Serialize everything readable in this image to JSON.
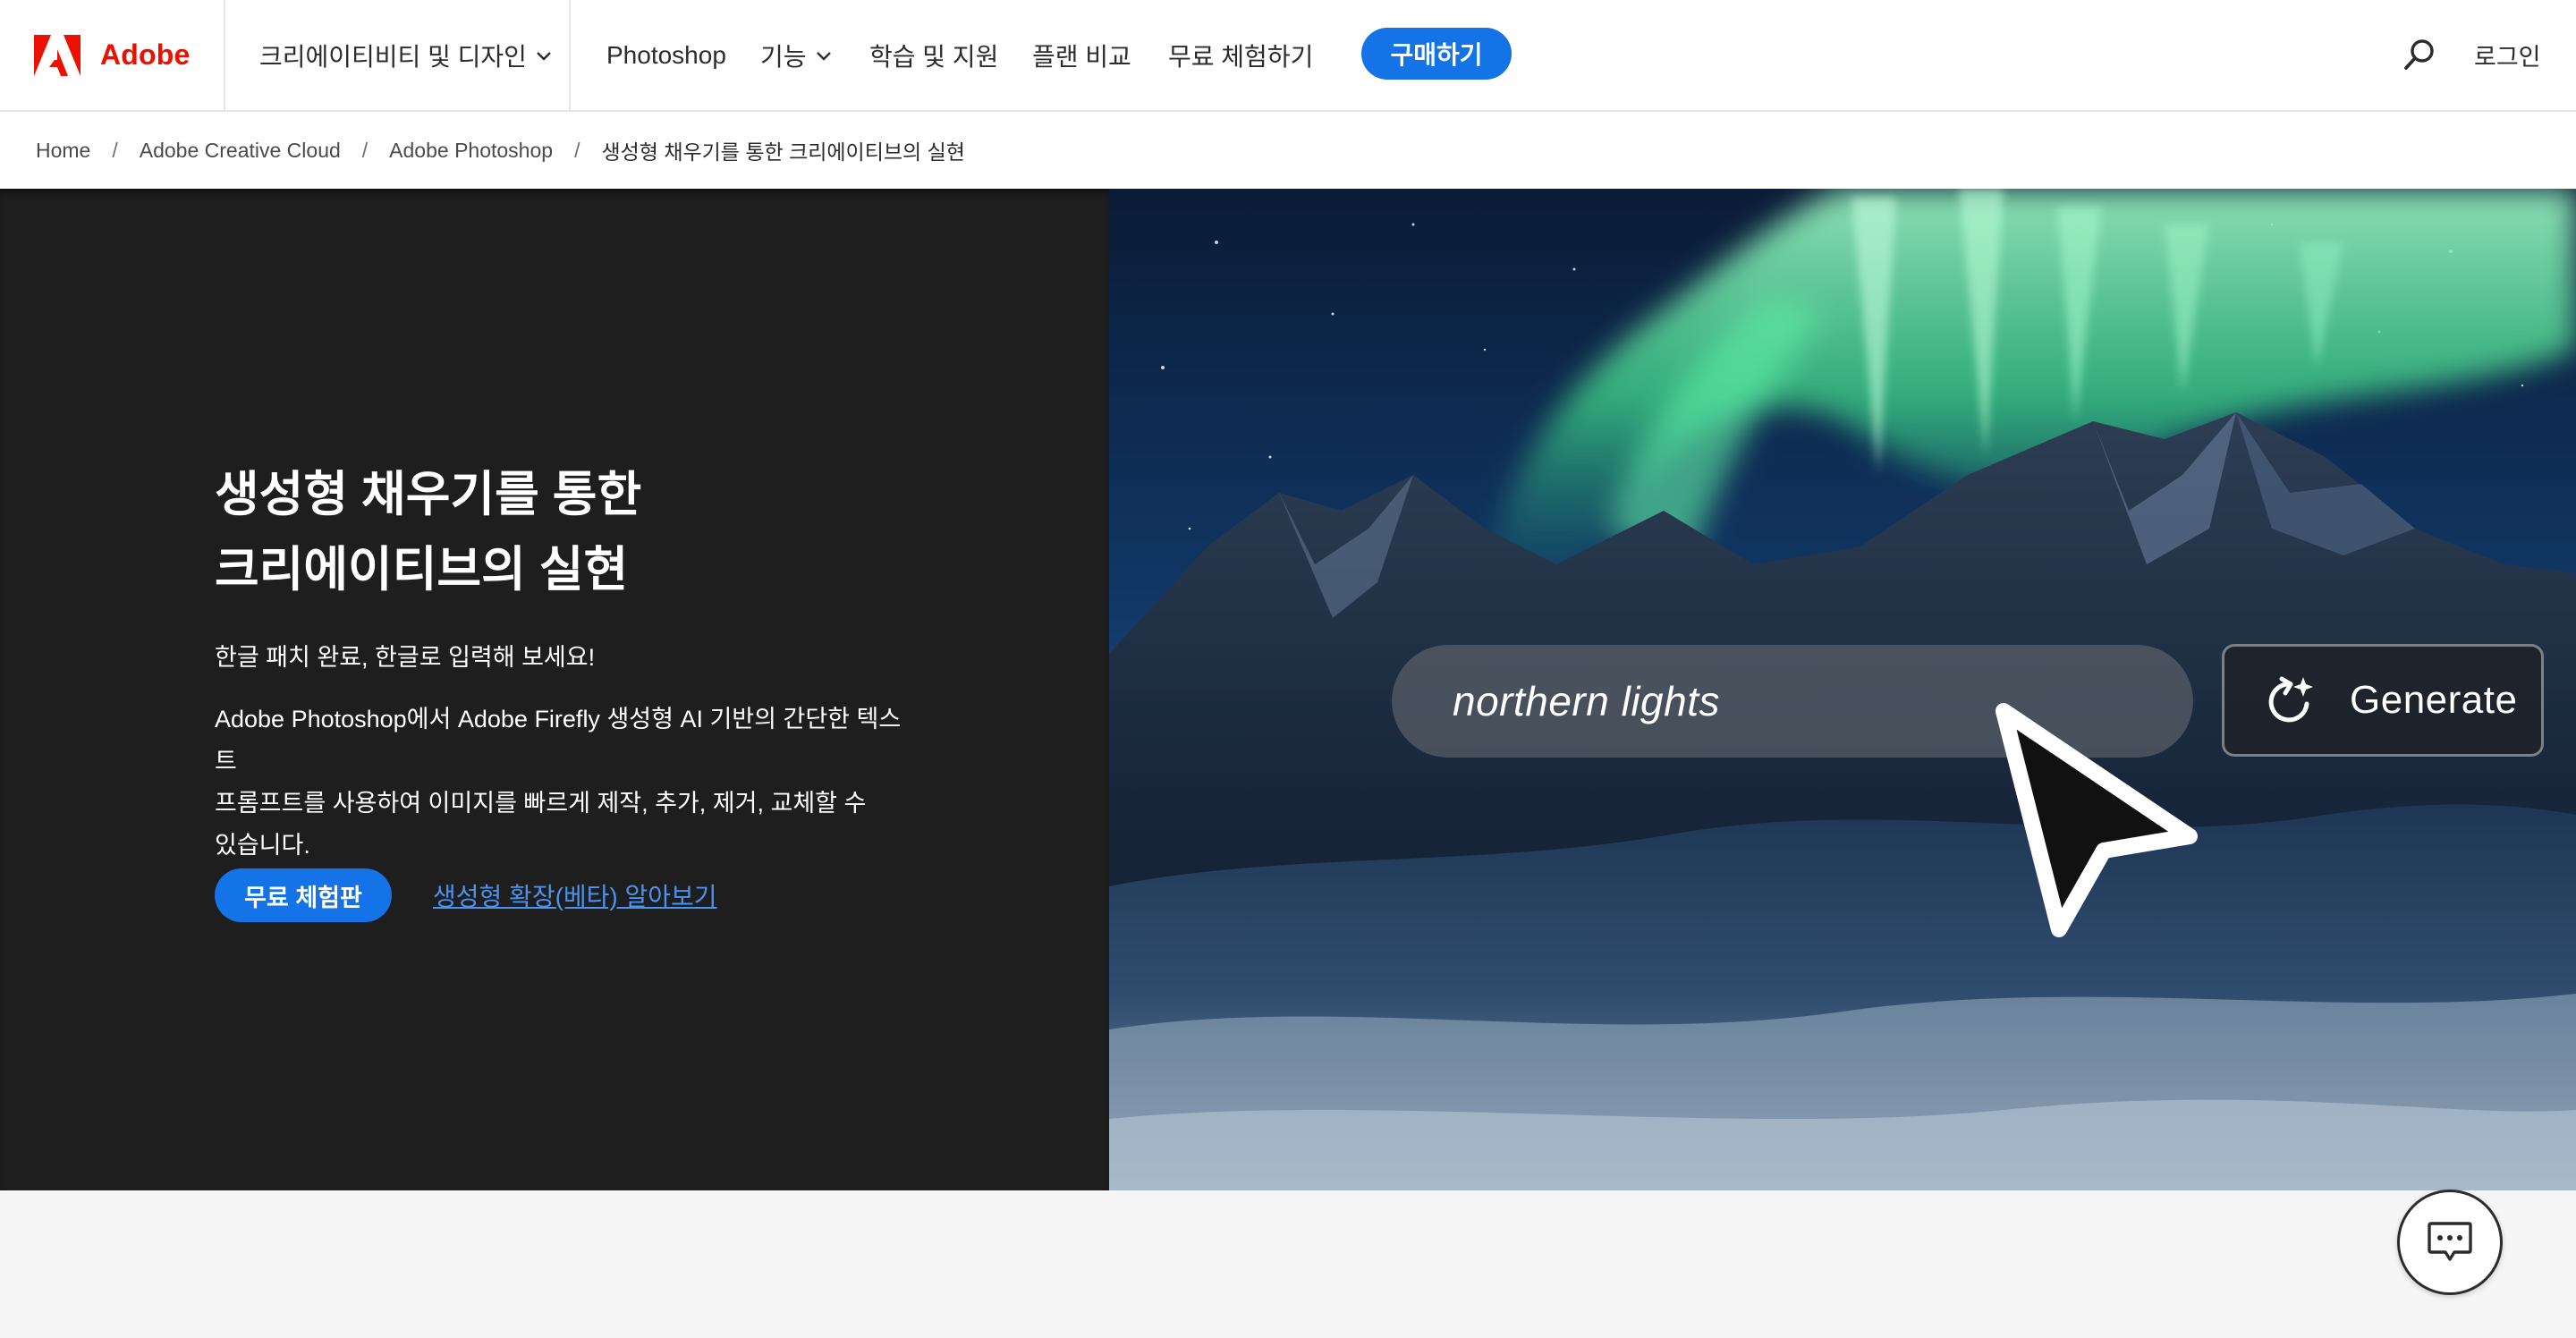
{
  "brand": {
    "name": "Adobe",
    "color": "#eb1000"
  },
  "nav": {
    "category": "크리에이티비티 및 디자인",
    "product": "Photoshop",
    "features": "기능",
    "learn": "학습 및 지원",
    "plans": "플랜 비교",
    "free_trial": "무료 체험하기",
    "buy": "구매하기",
    "login": "로그인",
    "accent": "#1473e6"
  },
  "breadcrumb": {
    "items": [
      "Home",
      "Adobe Creative Cloud",
      "Adobe Photoshop",
      "생성형 채우기를 통한 크리에이티브의 실현"
    ],
    "separator": "/"
  },
  "hero": {
    "title_line1": "생성형 채우기를 통한",
    "title_line2": "크리에이티브의 실현",
    "subtitle": "한글 패치 완료, 한글로 입력해 보세요!",
    "description_line1": "Adobe Photoshop에서 Adobe Firefly 생성형 AI 기반의 간단한 텍스트",
    "description_line2": "프롬프트를 사용하여 이미지를 빠르게 제작, 추가, 제거, 교체할 수",
    "description_line3": "있습니다.",
    "cta_primary": "무료 체험판",
    "cta_link": "생성형 확장(베타) 알아보기",
    "background": "#1e1e1e",
    "link_color": "#4a93f0"
  },
  "demo": {
    "prompt": "northern lights",
    "button": "Generate",
    "scene": "aurora-over-mountains"
  },
  "icons": {
    "search": "search-icon",
    "chevron": "chevron-down-icon",
    "chat": "chat-icon",
    "generate": "generate-sparkle-icon",
    "cursor": "cursor-arrow-icon"
  }
}
